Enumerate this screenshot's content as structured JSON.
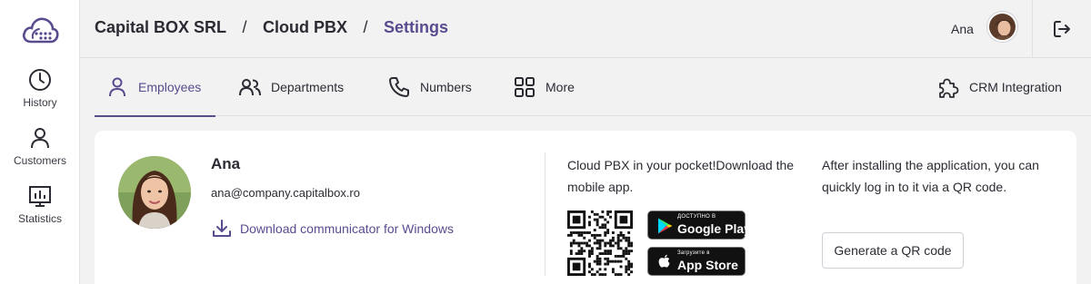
{
  "sidebar": {
    "logo": "cloud-logo",
    "items": [
      {
        "label": "History",
        "icon": "clock-icon"
      },
      {
        "label": "Customers",
        "icon": "person-icon"
      },
      {
        "label": "Statistics",
        "icon": "chart-icon"
      }
    ]
  },
  "header": {
    "breadcrumb": [
      "Capital BOX SRL",
      "Cloud PBX",
      "Settings"
    ],
    "separator": "/",
    "user_name": "Ana"
  },
  "tabs": [
    {
      "label": "Employees",
      "icon": "person-icon",
      "active": true
    },
    {
      "label": "Departments",
      "icon": "people-icon",
      "active": false
    },
    {
      "label": "Numbers",
      "icon": "phone-icon",
      "active": false
    },
    {
      "label": "More",
      "icon": "grid-icon",
      "active": false
    },
    {
      "label": "CRM Integration",
      "icon": "puzzle-icon",
      "active": false
    }
  ],
  "profile": {
    "name": "Ana",
    "email": "ana@company.capitalbox.ro",
    "download_label": "Download communicator for Windows"
  },
  "mobile": {
    "pocket_text": "Cloud PBX in your pocket!Download the mobile app.",
    "google_play": {
      "top": "ДОСТУПНО В",
      "main": "Google Play"
    },
    "app_store": {
      "top": "Загрузите в",
      "main": "App Store"
    },
    "after_text": "After installing the application, you can quickly log in to it via a QR code.",
    "qr_button_label": "Generate a QR code"
  },
  "colors": {
    "accent": "#5a4b8f",
    "background": "#f2f2f3",
    "card": "#ffffff"
  }
}
